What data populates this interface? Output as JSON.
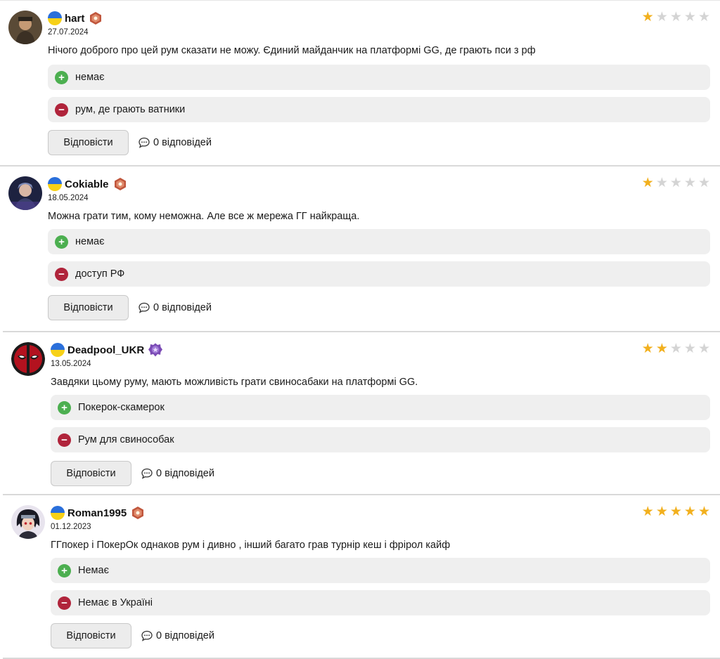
{
  "reviews": [
    {
      "username": "hart",
      "date": "27.07.2024",
      "text": "Нічого доброго про цей рум сказати не можу.  Єдиний майданчик на платформі GG, де грають пси з рф",
      "pro": "немає",
      "con": "рум, де грають ватники",
      "reply_label": "Відповісти",
      "replies_label": "0 відповідей",
      "rating": 1,
      "max_rating": 5,
      "badge": "red-badge-icon",
      "avatar": "man-portrait-avatar"
    },
    {
      "username": "Cokiable",
      "date": "18.05.2024",
      "text": "Можна грати тим, кому неможна. Але все ж мережа ГГ найкраща.",
      "pro": "немає",
      "con": "доступ РФ",
      "reply_label": "Відповісти",
      "replies_label": "0 відповідей",
      "rating": 1,
      "max_rating": 5,
      "badge": "red-badge-icon",
      "avatar": "character-avatar"
    },
    {
      "username": "Deadpool_UKR",
      "date": "13.05.2024",
      "text": "Завдяки цьому руму, мають можливість грати свиносабаки на платформі GG.",
      "pro": "Покерок-скамерок",
      "con": "Рум для свинособак",
      "reply_label": "Відповісти",
      "replies_label": "0 відповідей",
      "rating": 2,
      "max_rating": 5,
      "badge": "purple-badge-icon",
      "avatar": "deadpool-avatar"
    },
    {
      "username": "Roman1995",
      "date": "01.12.2023",
      "text": "ГГпокер і ПокерОк однаков рум і дивно , інший багато грав турнір кеш і фрірол кайф",
      "pro": "Немає",
      "con": "Немає в Україні",
      "reply_label": "Відповісти",
      "replies_label": "0 відповідей",
      "rating": 5,
      "max_rating": 5,
      "badge": "red-badge-icon",
      "avatar": "anime-avatar"
    }
  ],
  "colors": {
    "star_on": "#f2b01e",
    "star_off": "#d4d4d4",
    "plus": "#4caf50",
    "minus": "#b0243b"
  }
}
